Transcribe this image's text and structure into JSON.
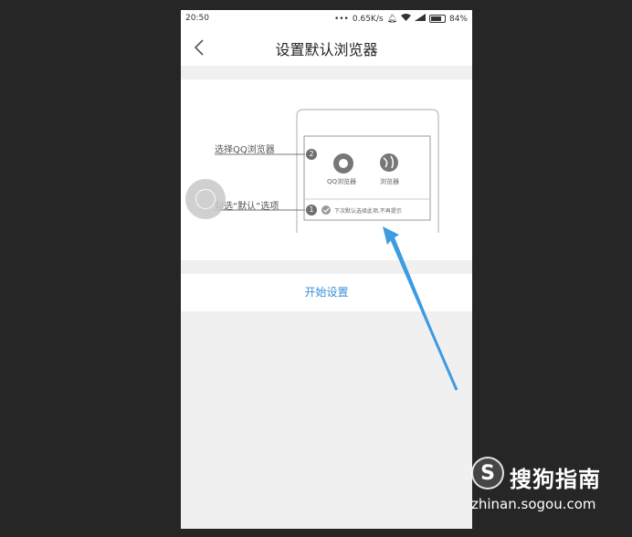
{
  "status_bar": {
    "time": "20:50",
    "network_speed": "0.65K/s",
    "battery": "84%"
  },
  "header": {
    "back_icon": "chevron-left-icon",
    "title": "设置默认浏览器"
  },
  "illustration": {
    "step2_label": "选择QQ浏览器",
    "step1_label": "勾选“默认”选项",
    "step2_number": "2",
    "step1_number": "1",
    "app1_label": "QQ浏览器",
    "app2_label": "浏览器",
    "checkbox_text": "下次默认选择此项,不再提示"
  },
  "action": {
    "start_label": "开始设置"
  },
  "watermark": {
    "title": "搜狗指南",
    "url": "zhinan.sogou.com",
    "logo_letter": "S"
  },
  "colors": {
    "accent": "#3a8fd6",
    "arrow": "#3d9be0",
    "page_bg": "#f0f0f0",
    "outer_bg": "#262626"
  }
}
